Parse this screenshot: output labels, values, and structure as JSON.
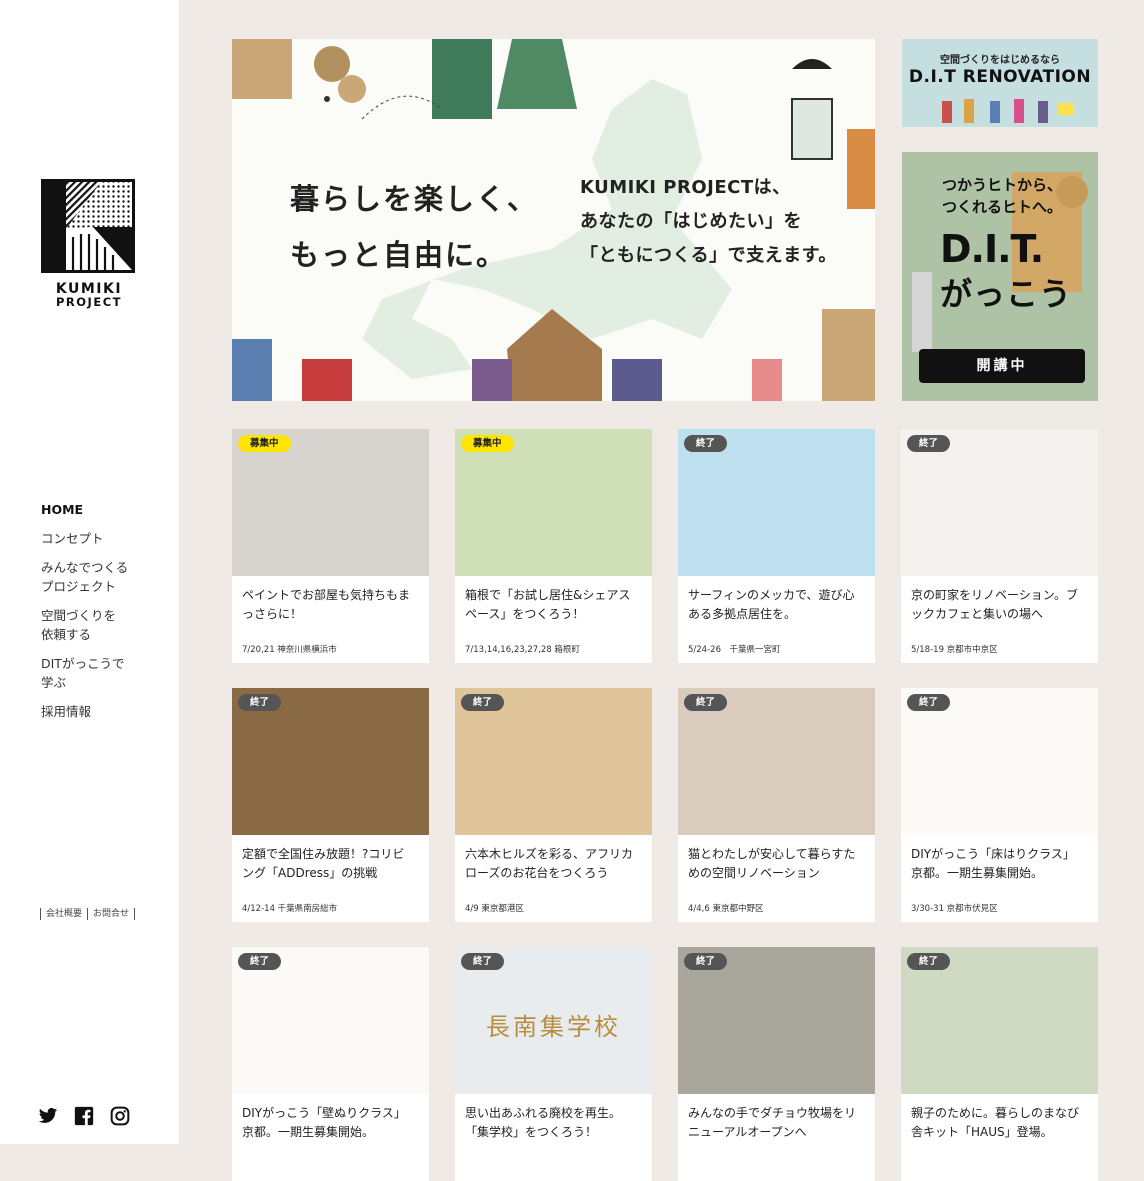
{
  "logo": {
    "line1": "KUMIKI",
    "line2": "PROJECT"
  },
  "nav": [
    "HOME",
    "コンセプト",
    "みんなでつくる\nプロジェクト",
    "空間づくりを\n依頼する",
    "DITがっこうで\n学ぶ",
    "採用情報"
  ],
  "footer_links": [
    "会社概要",
    "お問合せ"
  ],
  "social": [
    "twitter-icon",
    "facebook-icon",
    "instagram-icon"
  ],
  "hero": {
    "headline": "暮らしを楽しく、\nもっと自由に。",
    "subline": "KUMIKI PROJECTは、\nあなたの「はじめたい」を\n「ともにつくる」で支えます。"
  },
  "banner_renovation": {
    "small": "空間づくりをはじめるなら",
    "big": "D.I.T RENOVATION"
  },
  "banner_school": {
    "tag": "つかうヒトから、\nつくれるヒトへ。",
    "title": "D.I.T.",
    "title2": "がっこう",
    "button": "開講中"
  },
  "cards": [
    {
      "badge": "募集中",
      "status": "open",
      "title": "ペイントでお部屋も気持ちもま\nっさらに！",
      "meta": "7/20,21 神奈川県横浜市",
      "thumb_color": "#d7d3cf"
    },
    {
      "badge": "募集中",
      "status": "open",
      "title": "箱根で「お試し居住&シェアス\nペース」をつくろう！",
      "meta": "7/13,14,16,23,27,28 箱根町",
      "thumb_color": "#cfe0b8"
    },
    {
      "badge": "終了",
      "status": "closed",
      "title": "サーフィンのメッカで、遊び心\nある多拠点居住を。",
      "meta": "5/24-26　千葉県一宮町",
      "thumb_color": "#bfe0ee"
    },
    {
      "badge": "終了",
      "status": "closed",
      "title": "京の町家をリノベーション。ブ\nックカフェと集いの場へ",
      "meta": "5/18-19 京都市中京区",
      "thumb_color": "#f3f2ef"
    },
    {
      "badge": "終了",
      "status": "closed",
      "title": "定額で全国住み放題！?コリビ\nング「ADDress」の挑戦",
      "meta": "4/12-14 千葉県南房総市",
      "thumb_color": "#8a6a44"
    },
    {
      "badge": "終了",
      "status": "closed",
      "title": "六本木ヒルズを彩る、アフリカ\nローズのお花台をつくろう",
      "meta": "4/9 東京都港区",
      "thumb_color": "#e0c49a"
    },
    {
      "badge": "終了",
      "status": "closed",
      "title": "猫とわたしが安心して暮らすた\nめの空間リノベーション",
      "meta": "4/4,6 東京都中野区",
      "thumb_color": "#d9ccbf"
    },
    {
      "badge": "終了",
      "status": "closed",
      "title": "DIYがっこう「床はりクラス」\n京都。一期生募集開始。",
      "meta": "3/30-31 京都市伏見区",
      "thumb_color": "#fbfaf6"
    },
    {
      "badge": "終了",
      "status": "closed",
      "title": "DIYがっこう「壁ぬりクラス」\n京都。一期生募集開始。",
      "meta": "",
      "thumb_color": "#fbfaf6"
    },
    {
      "badge": "終了",
      "status": "closed",
      "title": "思い出あふれる廃校を再生。\n「集学校」をつくろう！",
      "meta": "",
      "thumb_color": "#e9ecef",
      "overlay": "長南集学校"
    },
    {
      "badge": "終了",
      "status": "closed",
      "title": "みんなの手でダチョウ牧場をリ\nニューアルオープンへ",
      "meta": "",
      "thumb_color": "#a9a69c"
    },
    {
      "badge": "終了",
      "status": "closed",
      "title": "親子のために。暮らしのまなび\n舎キット「HAUS」登場。",
      "meta": "",
      "thumb_color": "#cfd9c3"
    }
  ]
}
